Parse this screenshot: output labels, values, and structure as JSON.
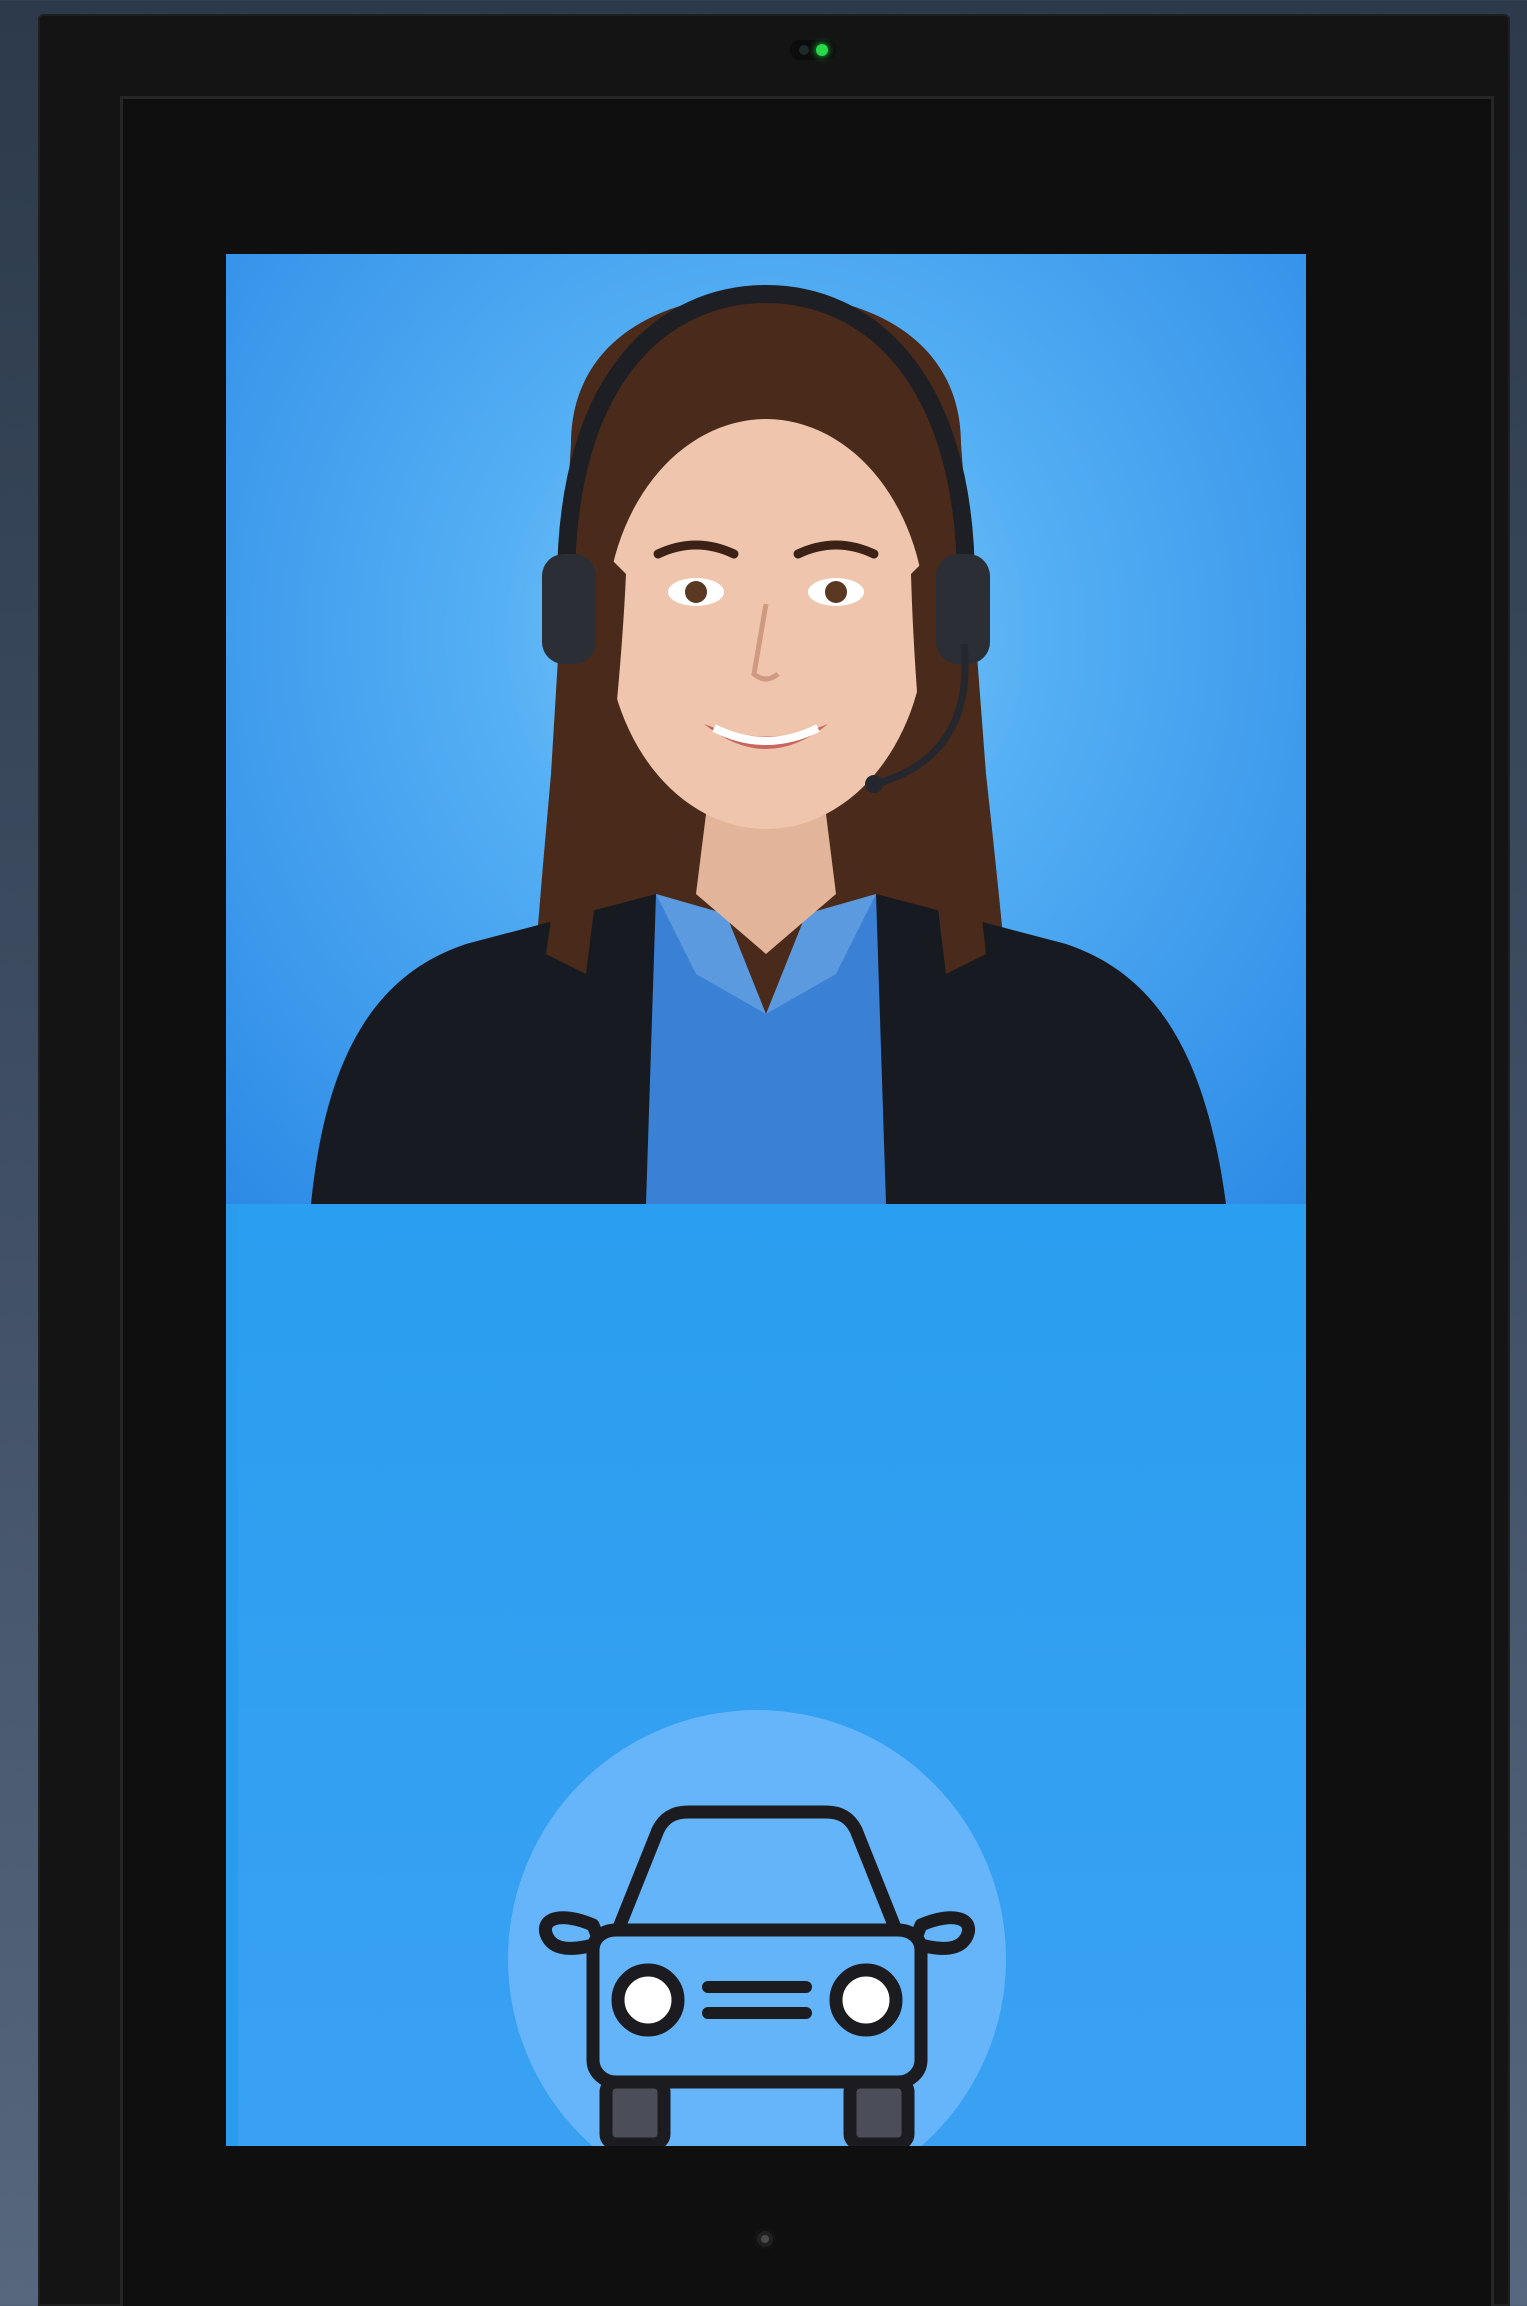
{
  "kiosk": {
    "status_led": "on",
    "accent_color": "#2a9cee",
    "agent": {
      "icon": "customer-support-agent-avatar"
    },
    "service_button": {
      "icon": "car-icon"
    }
  }
}
